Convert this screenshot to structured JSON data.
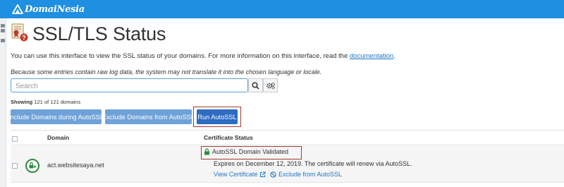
{
  "brand": {
    "name": "DomaiNesia",
    "bar_color": "#1e8fe1"
  },
  "page": {
    "title": "SSL/TLS Status",
    "title_icon": "certificate-warning-icon"
  },
  "intro": {
    "text": "You can use this interface to view the SSL status of your domains. For more information on this interface, read the ",
    "link_text": "documentation",
    "suffix": "."
  },
  "note": "Because some entries contain raw log data, the system may not translate it into the chosen language or locale.",
  "search": {
    "placeholder": "Search",
    "value": "",
    "search_icon": "search-icon",
    "settings_icon": "gears-icon"
  },
  "showing": {
    "label": "Showing",
    "text": "121 of 121 domains"
  },
  "actions": {
    "include": "Include Domains during AutoSSL",
    "exclude": "Exclude Domains from AutoSSL",
    "run": "Run AutoSSL"
  },
  "table": {
    "columns": [
      "Domain",
      "Certificate Status"
    ],
    "rows": [
      {
        "status_icon": "lock-status-icon",
        "domain": "act.websitesaya.net",
        "status": "AutoSSL Domain Validated",
        "expires": "Expires on December 12, 2019. The certificate will renew via AutoSSL.",
        "view_link": "View Certificate",
        "exclude_link": "Exclude from AutoSSL"
      }
    ]
  },
  "colors": {
    "accent": "#2d6cc0",
    "button_light": "#6fa2d8",
    "link": "#1f75c4",
    "highlight_frame": "#a23b2b",
    "valid_green": "#2e8b3e"
  }
}
